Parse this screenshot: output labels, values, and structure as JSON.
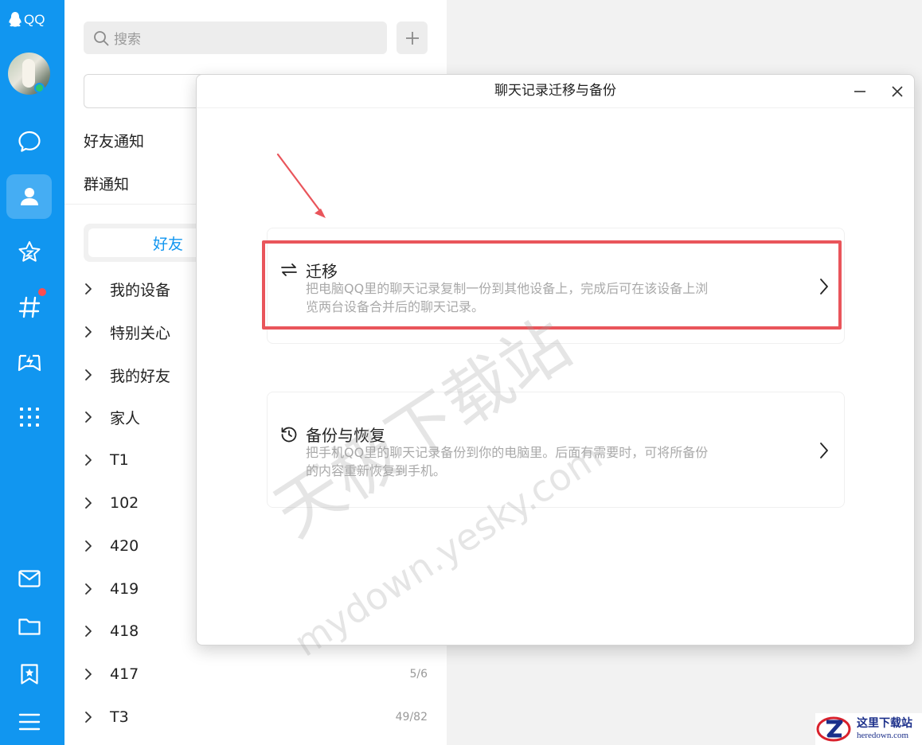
{
  "app": {
    "brand": "QQ"
  },
  "sidebar": {
    "items": [
      {
        "icon": "chat-bubble-icon",
        "active": false
      },
      {
        "icon": "contacts-icon",
        "active": true
      },
      {
        "icon": "zone-star-icon",
        "active": false
      },
      {
        "icon": "channel-hash-icon",
        "active": false,
        "badge": "red-dot"
      },
      {
        "icon": "games-icon",
        "active": false
      },
      {
        "icon": "apps-grid-icon",
        "active": false
      },
      {
        "icon": "mail-icon",
        "active": false
      },
      {
        "icon": "folder-icon",
        "active": false
      },
      {
        "icon": "favorites-icon",
        "active": false
      },
      {
        "icon": "menu-icon",
        "active": false
      }
    ]
  },
  "contacts": {
    "search_placeholder": "搜索",
    "notifications": [
      "好友通知",
      "群通知"
    ],
    "tab_friends": "好友",
    "groups": [
      {
        "name": "我的设备",
        "count": ""
      },
      {
        "name": "特别关心",
        "count": ""
      },
      {
        "name": "我的好友",
        "count": ""
      },
      {
        "name": "家人",
        "count": ""
      },
      {
        "name": "T1",
        "count": ""
      },
      {
        "name": "102",
        "count": ""
      },
      {
        "name": "420",
        "count": ""
      },
      {
        "name": "419",
        "count": ""
      },
      {
        "name": "418",
        "count": ""
      },
      {
        "name": "417",
        "count": "5/6"
      },
      {
        "name": "T3",
        "count": "49/82"
      }
    ]
  },
  "dialog": {
    "title": "聊天记录迁移与备份",
    "options": [
      {
        "title": "迁移",
        "icon": "swap-arrows-icon",
        "desc_lines": [
          "把电脑QQ里的聊天记录复制一份到其他设备上，完成后可在该设备上浏",
          "览两台设备合并后的聊天记录。"
        ],
        "highlighted": true
      },
      {
        "title": "备份与恢复",
        "icon": "history-clock-icon",
        "desc_lines": [
          "把手机QQ里的聊天记录备份到你的电脑里。后面有需要时，可将所备份",
          "的内容重新恢复到手机。"
        ],
        "highlighted": false
      }
    ]
  },
  "watermark": {
    "cn": "天极下载站",
    "en": "mydown.yesky.com"
  },
  "corner_logo": {
    "cn": "这里下载站",
    "en": "heredown.com"
  },
  "colors": {
    "rail": "#1196f0",
    "accent": "#1196f0",
    "highlight": "#e9555b"
  }
}
